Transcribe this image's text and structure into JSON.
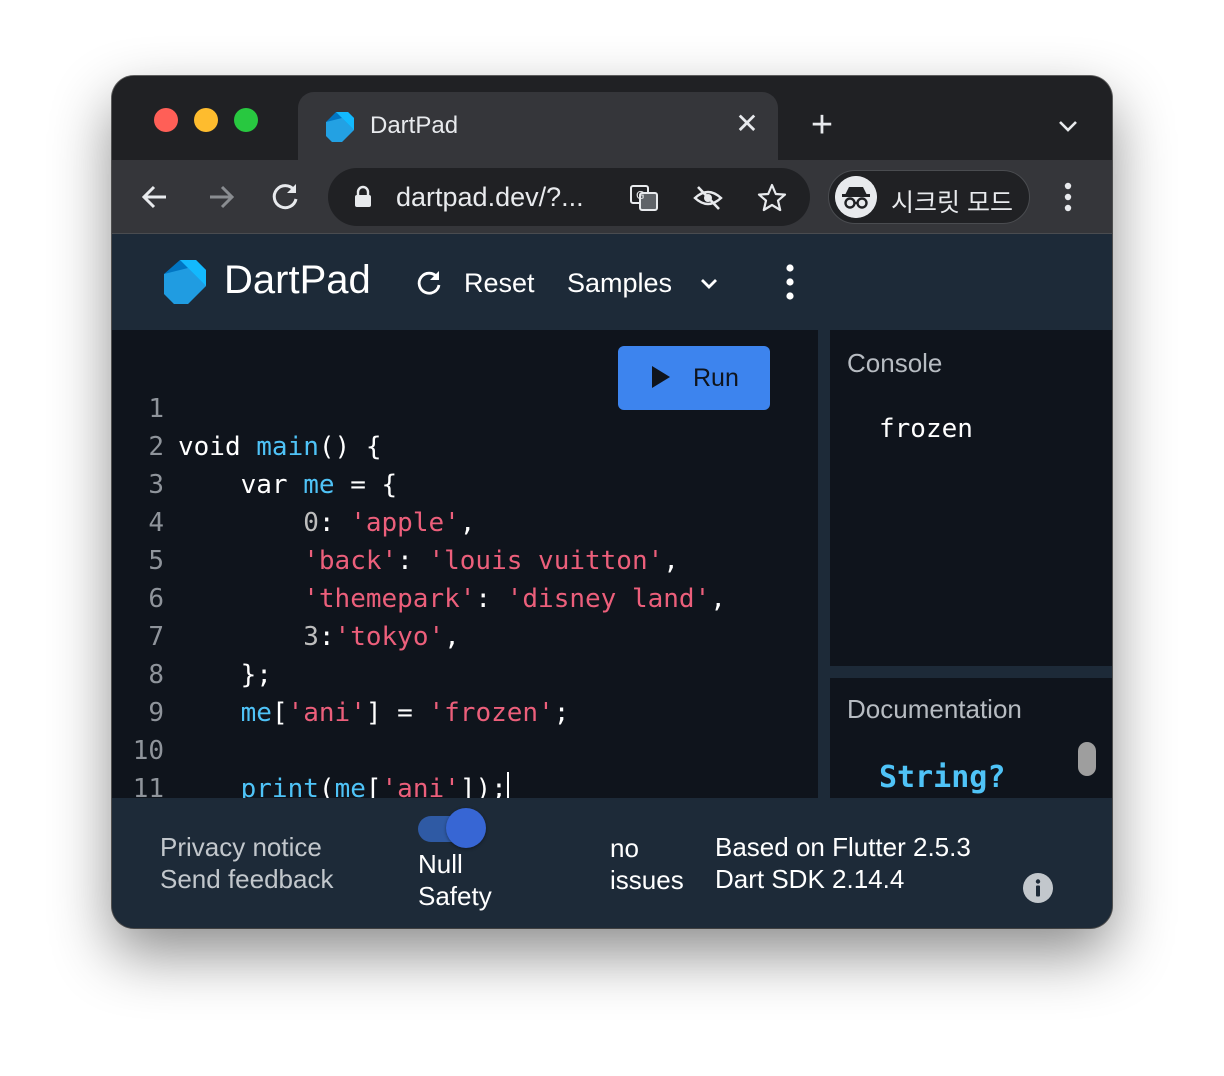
{
  "browser": {
    "tab_title": "DartPad",
    "url": "dartpad.dev/?...",
    "profile_label": "시크릿 모드",
    "icons": {
      "back": "arrow-left-icon",
      "forward": "arrow-right-icon",
      "reload": "reload-icon",
      "lock": "lock-icon",
      "translate": "translate-icon",
      "tracking": "eye-off-icon",
      "bookmark": "star-icon",
      "incognito": "incognito-icon",
      "menu": "kebab-menu-icon",
      "new_tab": "plus-icon",
      "tab_search": "chevron-down-icon",
      "close_tab": "close-icon"
    },
    "colors": {
      "frame": "#202124",
      "toolbar": "#35363a",
      "traffic_red": "#ff5f57",
      "traffic_yellow": "#febc2e",
      "traffic_green": "#28c840"
    }
  },
  "app": {
    "brand": "DartPad",
    "reset_label": "Reset",
    "samples_label": "Samples",
    "run_label": "Run",
    "colors": {
      "appbar": "#1d2a38",
      "editor_bg": "#0f141c",
      "run_button": "#3d84ee",
      "identifier": "#4fc3f7",
      "string": "#ec5f7b"
    }
  },
  "editor": {
    "line_numbers": [
      "1",
      "2",
      "3",
      "4",
      "5",
      "6",
      "7",
      "8",
      "9",
      "10",
      "11"
    ],
    "tokens": {
      "void": "void",
      "main": "main",
      "main_open": "() {",
      "var": "var",
      "me": "me",
      "assign_brace": "= {",
      "zero": "0",
      "colon": ":",
      "comma": ",",
      "apple": "'apple'",
      "back": "'back'",
      "louis_vuitton": "'louis vuitton'",
      "themepark": "'themepark'",
      "disney_land": "'disney land'",
      "three": "3",
      "tokyo": "'tokyo'",
      "close_map": "};",
      "lbracket": "[",
      "ani": "'ani'",
      "rbracket_eq": "] =",
      "frozen": "'frozen'",
      "semicolon": ";",
      "print": "print",
      "lparen": "(",
      "rbrackets_paren": "]);",
      "close_main": "}"
    }
  },
  "console": {
    "title": "Console",
    "output": "frozen"
  },
  "documentation": {
    "title": "Documentation",
    "type_name": "String?"
  },
  "footer": {
    "privacy": "Privacy notice",
    "feedback": "Send feedback",
    "null_safety_label": "Null Safety",
    "null_safety_enabled": true,
    "issues": "no issues",
    "flutter_version": "Based on Flutter 2.5.3",
    "dart_sdk": "Dart SDK 2.14.4",
    "info_icon": "info-icon"
  }
}
